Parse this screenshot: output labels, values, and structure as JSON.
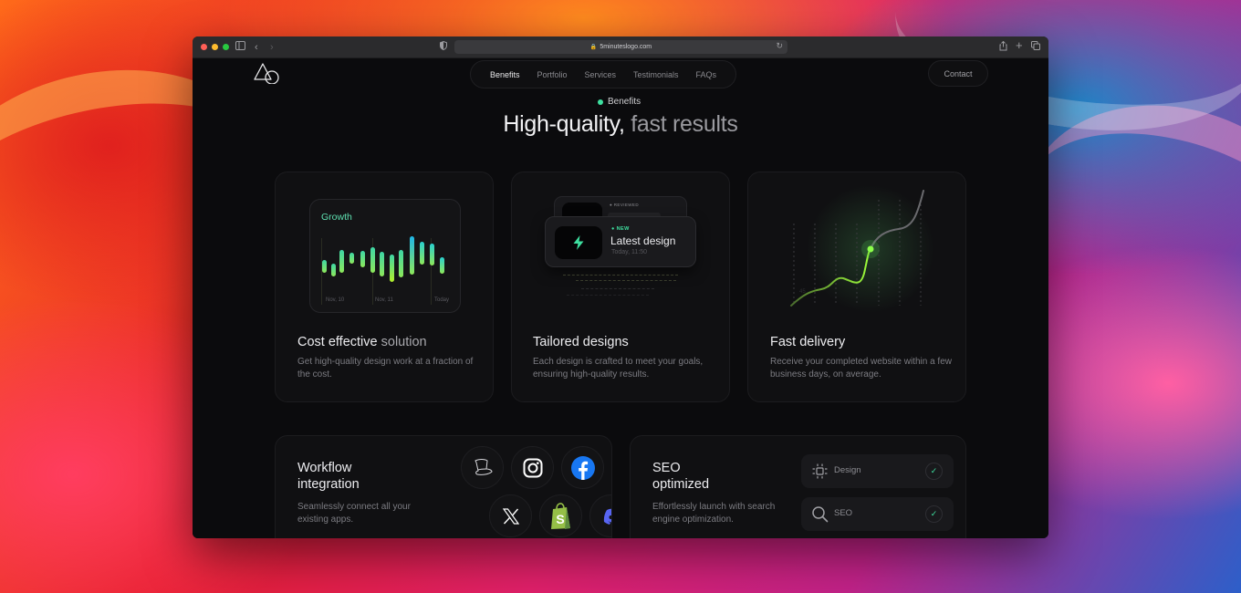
{
  "browser": {
    "url": "5minuteslogo.com",
    "traffic_lights": [
      "#ff5f57",
      "#febc2e",
      "#28c840"
    ]
  },
  "nav": {
    "items": [
      {
        "label": "Benefits",
        "active": true
      },
      {
        "label": "Portfolio",
        "active": false
      },
      {
        "label": "Services",
        "active": false
      },
      {
        "label": "Testimonials",
        "active": false
      },
      {
        "label": "FAQs",
        "active": false
      }
    ],
    "contact_label": "Contact"
  },
  "section": {
    "eyebrow": "Benefits",
    "headline_strong": "High-quality,",
    "headline_dim": "fast results",
    "accent": "#3ee0a0"
  },
  "cards": {
    "cost": {
      "title_strong": "Cost effective",
      "title_dim": "solution",
      "desc": "Get high-quality design work at a fraction of the cost.",
      "widget": {
        "title": "Growth",
        "labels": [
          "Nov, 10",
          "Nov, 11",
          "Today"
        ]
      }
    },
    "tailored": {
      "title": "Tailored designs",
      "desc": "Each design is crafted to meet your goals, ensuring high-quality results.",
      "widget": {
        "back_badge": "REVIEWED",
        "front_badge": "NEW",
        "front_title": "Latest design",
        "front_time": "Today, 11:50"
      }
    },
    "delivery": {
      "title": "Fast delivery",
      "desc": "Receive your completed website within a few business days, on average.",
      "widget": {
        "label": "45"
      }
    },
    "workflow": {
      "title_line1": "Workflow",
      "title_line2": "integration",
      "desc": "Seamlessly connect all your existing apps.",
      "apps": [
        "alfred-hat",
        "instagram",
        "facebook",
        "x",
        "shopify",
        "discord"
      ]
    },
    "seo": {
      "title_line1": "SEO",
      "title_line2": "optimized",
      "desc": "Effortlessly launch with search engine optimization.",
      "rows": [
        {
          "label": "Design",
          "icon": "frame-icon",
          "checked": true
        },
        {
          "label": "SEO",
          "icon": "search-icon",
          "checked": true
        }
      ]
    }
  }
}
